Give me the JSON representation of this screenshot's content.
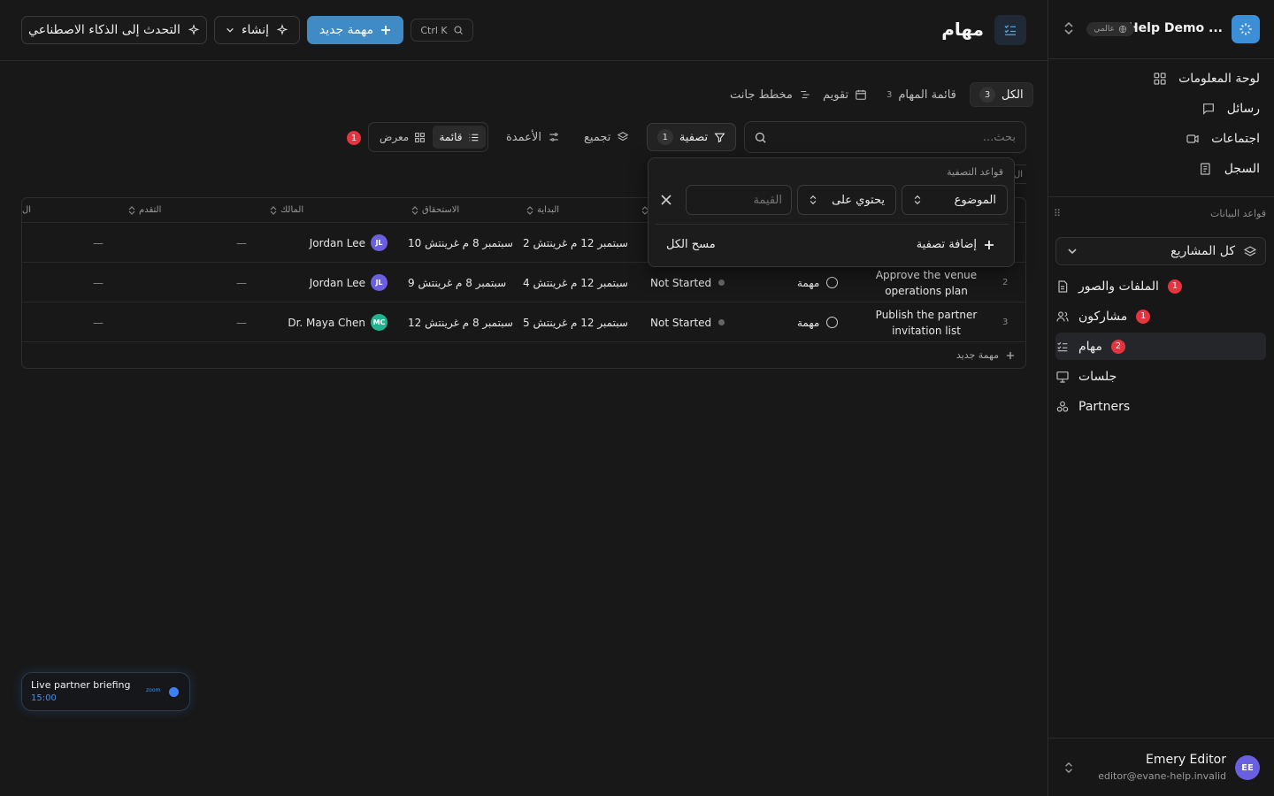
{
  "sidebar": {
    "workspace_name": "Help Demo ...",
    "workspace_badge": "عالمي",
    "nav": [
      {
        "label": "لوحة المعلومات"
      },
      {
        "label": "رسائل"
      },
      {
        "label": "اجتماعات"
      },
      {
        "label": "السجل"
      }
    ],
    "databases_label": "قواعد البيانات",
    "project_selector": "كل المشاريع",
    "db_items": [
      {
        "label": "الملفات والصور",
        "badge": "1"
      },
      {
        "label": "مشاركون",
        "badge": "1"
      },
      {
        "label": "مهام",
        "badge": "2"
      },
      {
        "label": "جلسات",
        "badge": ""
      },
      {
        "label": "Partners",
        "badge": ""
      }
    ],
    "user": {
      "name": "Emery Editor",
      "email": "editor@evane-help.invalid",
      "initials": "EE"
    }
  },
  "header": {
    "title": "مهام",
    "shortcut": "Ctrl K",
    "new_task": "مهمة جديد",
    "create": "إنشاء",
    "ai": "التحدث إلى الذكاء الاصطناعي"
  },
  "tabs": [
    {
      "label": "الكل",
      "count": "3"
    },
    {
      "label": "قائمة المهام",
      "count": "3"
    },
    {
      "label": "تقويم",
      "count": ""
    },
    {
      "label": "مخطط جانت",
      "count": ""
    }
  ],
  "toolbar": {
    "search_placeholder": "بحث...",
    "filter": "تصفية",
    "filter_count": "1",
    "group": "تجميع",
    "columns": "الأعمدة",
    "list": "قائمة",
    "gallery": "معرض",
    "alert_count": "1"
  },
  "filter_popover": {
    "title": "قواعد التصفية",
    "field": "الموضوع",
    "operator": "يحتوي على",
    "value_placeholder": "القيمة",
    "add": "إضافة تصفية",
    "clear": "مسح الكل"
  },
  "table": {
    "columns": {
      "start": "البداية",
      "due": "الاستحقاق",
      "owner": "المالك",
      "progress": "التقدم",
      "cut": "ال"
    },
    "side_stub": "ال",
    "rows": [
      {
        "num": "",
        "subject": "",
        "type": "",
        "status": "",
        "start": "2 سبتمبر 12 م غرينتش",
        "due": "10 سبتمبر 8 م غرينتش",
        "owner": "Jordan Lee",
        "initials": "JL",
        "avatar_color": "#6a5fe0",
        "progress": "—",
        "extra": "—"
      },
      {
        "num": "2",
        "subject": "Approve the venue operations plan",
        "type": "مهمة",
        "status": "Not Started",
        "start": "4 سبتمبر 12 م غرينتش",
        "due": "9 سبتمبر 8 م غرينتش",
        "owner": "Jordan Lee",
        "initials": "JL",
        "avatar_color": "#6a5fe0",
        "progress": "—",
        "extra": "—"
      },
      {
        "num": "3",
        "subject": "Publish the partner invitation list",
        "type": "مهمة",
        "status": "Not Started",
        "start": "5 سبتمبر 12 م غرينتش",
        "due": "12 سبتمبر 8 م غرينتش",
        "owner": "Dr. Maya Chen",
        "initials": "MC",
        "avatar_color": "#1fb58f",
        "progress": "—",
        "extra": "—"
      }
    ],
    "new_row": "مهمة جديد"
  },
  "toast": {
    "title": "Live partner briefing",
    "time": "15:00",
    "app": "zoom"
  }
}
